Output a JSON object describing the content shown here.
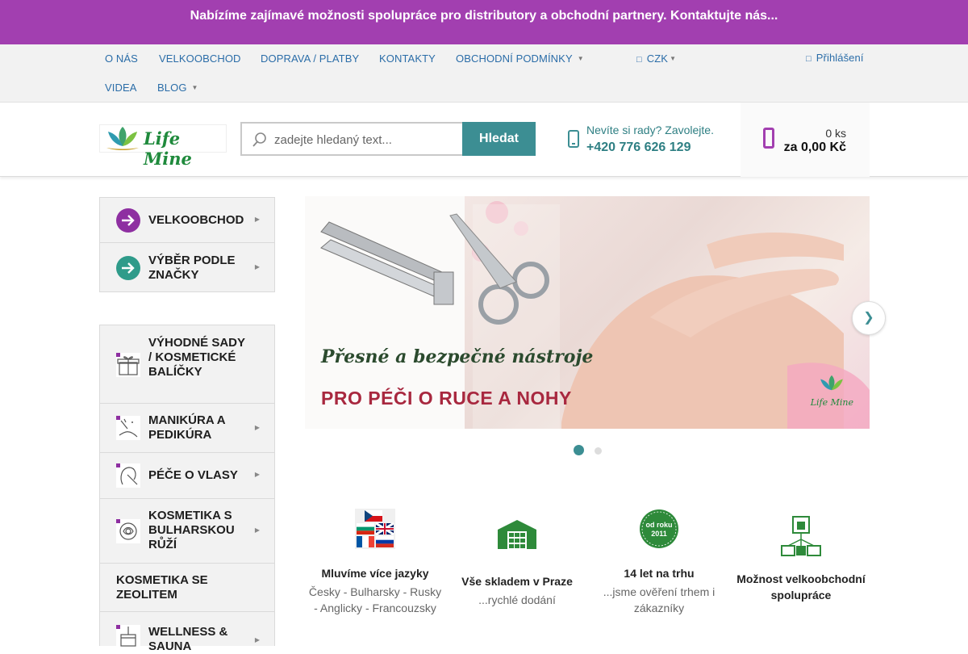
{
  "promo": {
    "text": "Nabízíme zajímavé možnosti spolupráce pro distributory a obchodní partnery. Kontaktujte nás..."
  },
  "topnav": {
    "items": [
      "O NÁS",
      "VELKOOBCHOD",
      "DOPRAVA / PLATBY",
      "KONTAKTY",
      "OBCHODNÍ PODMÍNKY",
      "VIDEA",
      "BLOG"
    ],
    "currency": "CZK",
    "login": "Přihlášení"
  },
  "header": {
    "logo_text": "Life Mine",
    "search_placeholder": "zadejte hledaný text...",
    "search_button": "Hledat",
    "help_question": "Nevíte si rady? Zavolejte.",
    "help_phone": "+420 776 626 129",
    "cart_count": "0 ks",
    "cart_total": "za 0,00 Kč"
  },
  "sidebar": {
    "top_items": [
      {
        "label": "VELKOOBCHOD",
        "icon": "arrow-right-circle-icon"
      },
      {
        "label": "VÝBĚR PODLE ZNAČKY",
        "icon": "arrow-right-circle-icon"
      }
    ],
    "items": [
      {
        "label": "VÝHODNÉ SADY / KOSMETICKÉ BALÍČKY",
        "icon": "gift-icon"
      },
      {
        "label": "MANIKÚRA A PEDIKÚRA",
        "icon": "manicure-icon"
      },
      {
        "label": "PÉČE O VLASY",
        "icon": "hair-care-icon"
      },
      {
        "label": "KOSMETIKA S BULHARSKOU RŮŽÍ",
        "icon": "rose-icon"
      },
      {
        "label": "KOSMETIKA SE ZEOLITEM",
        "icon": ""
      },
      {
        "label": "WELLNESS & SAUNA",
        "icon": "sauna-icon"
      }
    ]
  },
  "slider": {
    "headline": "Přesné a bezpečné nástroje",
    "subline": "PRO PÉČI O RUCE A NOHY",
    "logo_text": "Life Mine",
    "active_slide": 1,
    "slide_count": 2
  },
  "features": [
    {
      "title": "Mluvíme více jazyky",
      "desc": "Česky - Bulharsky - Rusky - Anglicky - Francouzsky",
      "icon": "flags-icon"
    },
    {
      "title": "Vše skladem v Praze",
      "desc": "...rychlé dodání",
      "icon": "warehouse-icon"
    },
    {
      "title": "14 let na trhu",
      "desc": "...jsme ověření trhem i zákazníky",
      "icon": "since-2011-badge-icon",
      "badge_line1": "od roku",
      "badge_line2": "2011"
    },
    {
      "title": "Možnost velkoobchodní spolupráce",
      "desc": "",
      "icon": "wholesale-network-icon"
    }
  ],
  "colors": {
    "brand_purple": "#a23fb0",
    "teal": "#3c8e93",
    "link_blue": "#2b6da8",
    "green": "#2e8a3a"
  }
}
